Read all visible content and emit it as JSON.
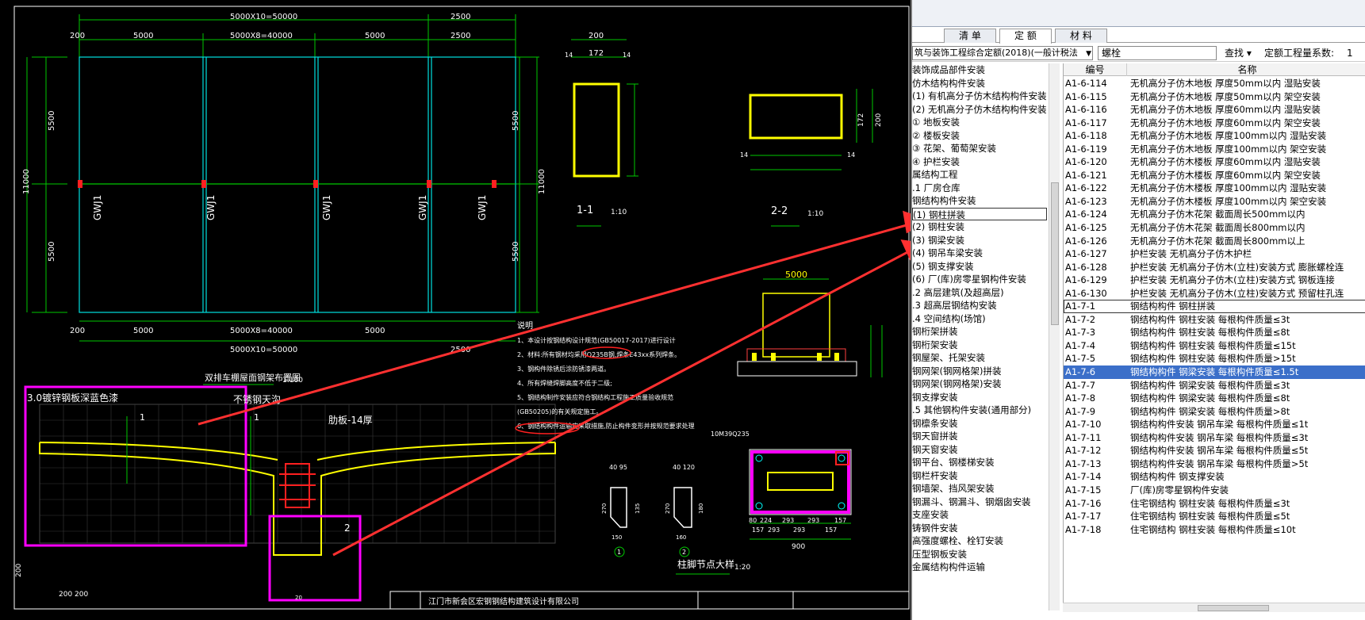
{
  "status": {
    "coord": "1"
  },
  "tabs": [
    {
      "label": "清 单"
    },
    {
      "label": "定 额"
    },
    {
      "label": "材 料"
    }
  ],
  "toolbar": {
    "library": "筑与装饰工程综合定额(2018)(一般计税法",
    "search_value": "螺栓",
    "find_label": "查找",
    "coef_label": "定额工程量系数:",
    "coef_value": "1"
  },
  "tree": [
    "装饰成品部件安装",
    "仿木结构构件安装",
    "(1) 有机高分子仿木结构构件安装",
    "(2) 无机高分子仿木结构构件安装",
    "  ① 地板安装",
    "  ② 楼板安装",
    "  ③ 花架、葡萄架安装",
    "  ④ 护栏安装",
    "属结构工程",
    ".1 厂房仓库",
    "钢结构构件安装",
    "(1) 钢柱拼装",
    "(2) 钢柱安装",
    "(3) 钢梁安装",
    "(4) 钢吊车梁安装",
    "(5) 钢支撑安装",
    "(6) 厂(库)房零星钢构件安装",
    ".2 高层建筑(及超高层)",
    ".3 超高层钢结构安装",
    ".4 空间结构(场馆)",
    "钢桁架拼装",
    "钢桁架安装",
    "钢屋架、托架安装",
    "钢网架(钢网格架)拼装",
    "钢网架(钢网格架)安装",
    "钢支撑安装",
    ".5 其他钢构件安装(通用部分)",
    "钢檩条安装",
    "钢天窗拼装",
    "钢天窗安装",
    "钢平台、钢楼梯安装",
    "钢栏杆安装",
    "钢墙架、挡风架安装",
    "钢漏斗、钢漏斗、钢烟囱安装",
    "支座安装",
    "铸钢件安装",
    "高强度螺栓、栓钉安装",
    "压型钢板安装",
    "金属结构构件运输"
  ],
  "grid": {
    "col_code": "编号",
    "col_name": "名称",
    "rows": [
      {
        "code": "A1-6-114",
        "name": "无机高分子仿木地板 厚度50mm以内 湿贴安装"
      },
      {
        "code": "A1-6-115",
        "name": "无机高分子仿木地板 厚度50mm以内 架空安装"
      },
      {
        "code": "A1-6-116",
        "name": "无机高分子仿木地板 厚度60mm以内 湿贴安装"
      },
      {
        "code": "A1-6-117",
        "name": "无机高分子仿木地板 厚度60mm以内 架空安装"
      },
      {
        "code": "A1-6-118",
        "name": "无机高分子仿木地板 厚度100mm以内 湿贴安装"
      },
      {
        "code": "A1-6-119",
        "name": "无机高分子仿木地板 厚度100mm以内 架空安装"
      },
      {
        "code": "A1-6-120",
        "name": "无机高分子仿木楼板 厚度60mm以内 湿贴安装"
      },
      {
        "code": "A1-6-121",
        "name": "无机高分子仿木楼板 厚度60mm以内 架空安装"
      },
      {
        "code": "A1-6-122",
        "name": "无机高分子仿木楼板 厚度100mm以内 湿贴安装"
      },
      {
        "code": "A1-6-123",
        "name": "无机高分子仿木楼板 厚度100mm以内 架空安装"
      },
      {
        "code": "A1-6-124",
        "name": "无机高分子仿木花架 截面周长500mm以内"
      },
      {
        "code": "A1-6-125",
        "name": "无机高分子仿木花架 截面周长800mm以内"
      },
      {
        "code": "A1-6-126",
        "name": "无机高分子仿木花架 截面周长800mm以上"
      },
      {
        "code": "A1-6-127",
        "name": "护栏安装 无机高分子仿木护栏"
      },
      {
        "code": "A1-6-128",
        "name": "护栏安装 无机高分子仿木(立柱)安装方式 膨胀螺栓连"
      },
      {
        "code": "A1-6-129",
        "name": "护栏安装 无机高分子仿木(立柱)安装方式 钢板连接"
      },
      {
        "code": "A1-6-130",
        "name": "护栏安装 无机高分子仿木(立柱)安装方式 预留柱孔连"
      },
      {
        "code": "A1-7-1",
        "name": "钢结构构件 钢柱拼装"
      },
      {
        "code": "A1-7-2",
        "name": "钢结构构件 钢柱安装 每根构件质量≤3t"
      },
      {
        "code": "A1-7-3",
        "name": "钢结构构件 钢柱安装 每根构件质量≤8t"
      },
      {
        "code": "A1-7-4",
        "name": "钢结构构件 钢柱安装 每根构件质量≤15t"
      },
      {
        "code": "A1-7-5",
        "name": "钢结构构件 钢柱安装 每根构件质量>15t"
      },
      {
        "code": "A1-7-6",
        "name": "钢结构构件 钢梁安装 每根构件质量≤1.5t"
      },
      {
        "code": "A1-7-7",
        "name": "钢结构构件 钢梁安装 每根构件质量≤3t"
      },
      {
        "code": "A1-7-8",
        "name": "钢结构构件 钢梁安装 每根构件质量≤8t"
      },
      {
        "code": "A1-7-9",
        "name": "钢结构构件 钢梁安装 每根构件质量>8t"
      },
      {
        "code": "A1-7-10",
        "name": "钢结构构件安装 钢吊车梁 每根构件质量≤1t"
      },
      {
        "code": "A1-7-11",
        "name": "钢结构构件安装 钢吊车梁 每根构件质量≤3t"
      },
      {
        "code": "A1-7-12",
        "name": "钢结构构件安装 钢吊车梁 每根构件质量≤5t"
      },
      {
        "code": "A1-7-13",
        "name": "钢结构构件安装 钢吊车梁 每根构件质量>5t"
      },
      {
        "code": "A1-7-14",
        "name": "钢结构构件 钢支撑安装"
      },
      {
        "code": "A1-7-15",
        "name": "厂(库)房零星钢构件安装"
      },
      {
        "code": "A1-7-16",
        "name": "住宅钢结构 钢柱安装 每根构件质量≤3t"
      },
      {
        "code": "A1-7-17",
        "name": "住宅钢结构 钢柱安装 每根构件质量≤5t"
      },
      {
        "code": "A1-7-18",
        "name": "住宅钢结构 钢柱安装 每根构件质量≤10t"
      }
    ]
  },
  "cad": {
    "dim_total": "5000X10=50000",
    "dim_total_b": "5000X10=50000",
    "dim_2500": "2500",
    "dim_2500b": "2500",
    "dim_5000a": "5000",
    "dim_mid": "5000X8=40000",
    "dim_5000b": "5000",
    "dim_5000c": "5000",
    "dim_mid_b": "5000X8=40000",
    "dim_5000d": "5000",
    "dim_200a": "200",
    "dim_200b": "200",
    "dim_5500a": "5500",
    "dim_5500b": "5500",
    "dim_5500c": "5500",
    "dim_5500d": "5500",
    "dim_11000a": "11000",
    "dim_11000b": "11000",
    "col_label": "GWJ1",
    "plan_title": "双排车棚屋面钢架布置图",
    "plan_scale": "1:100",
    "sec1_title": "1-1",
    "sec1_scale": "1:10",
    "sec2_title": "2-2",
    "sec2_scale": "1:10",
    "dim_200c": "200",
    "dim_172": "172",
    "dim_14a": "14",
    "dim_14b": "14",
    "dim_200d": "200",
    "dim_172b": "172",
    "dim_14c": "14",
    "dim_14d": "14",
    "note_paint": "3.0镀锌钢板深蓝色漆",
    "note_steel": "不锈钢天沟",
    "note_rib": "肋板-14厚",
    "label_1": "1",
    "label_1b": "1",
    "label_2": "2",
    "notes_title": "说明",
    "note_lines": [
      "1、本设计按钢结构设计规范(GB50017-2017)进行设计",
      "2、材料:所有钢材均采用Q235B钢,焊条E43xx系列焊条。",
      "3、钢构件除锈后涂防锈漆两道。",
      "4、所有焊缝焊脚高度不低于二级;",
      "5、钢结构制作安装应符合钢结构工程施工质量验收规范",
      "   (GB50205)的有关规定施工。",
      "6、钢结构构件运输应采取措施,防止构件变形并按规范要求处理"
    ],
    "detail_title": "柱脚节点大样",
    "detail_scale": "1:20",
    "dim_5000top": "5000",
    "bolt_note": "10M39Q235",
    "dim_900": "900",
    "dims_bottom": [
      "80",
      "224",
      "293",
      "293",
      "157"
    ],
    "dims_bottom2": [
      "157",
      "293",
      "293",
      "157"
    ],
    "dim_40x95": "40 95",
    "dim_40x120": "40 120",
    "dim_270a": "270",
    "dim_135": "135",
    "dim_270b": "270",
    "dim_180": "180",
    "dim_150": "150",
    "dim_160": "160",
    "circ1": "1",
    "circ2": "2",
    "company": "江门市新会区宏钢钢结构建筑设计有限公司",
    "dim_200e": "200",
    "dim_200f": "200 200",
    "dim_20": "20"
  }
}
